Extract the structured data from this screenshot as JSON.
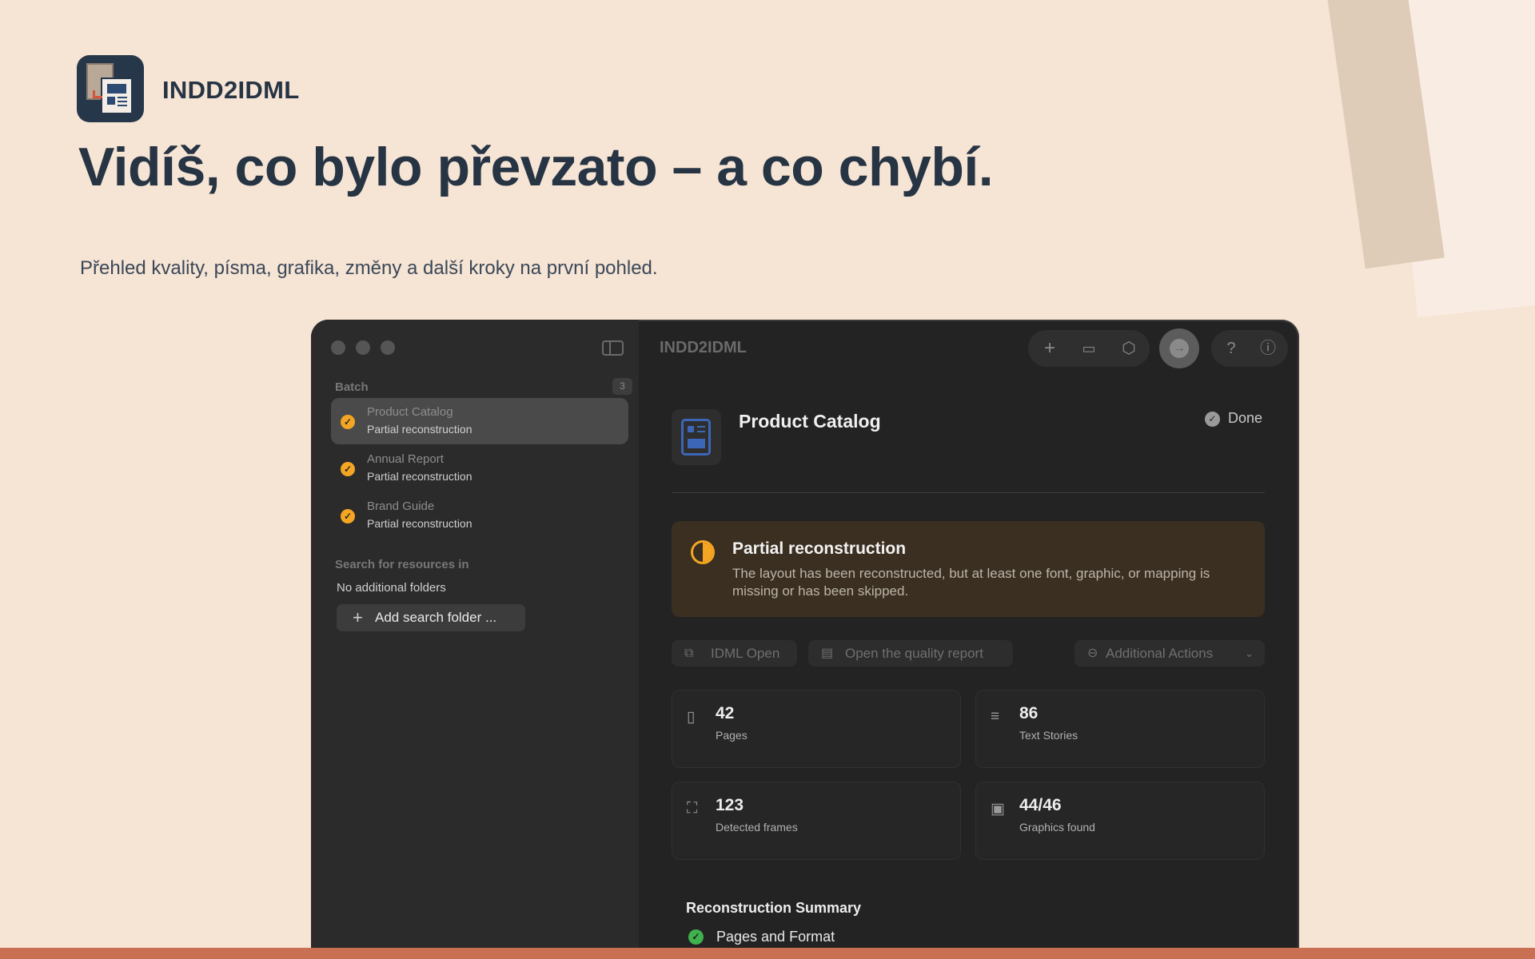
{
  "brand": {
    "name": "INDD2IDML"
  },
  "hero": {
    "headline": "Vidíš, co bylo převzato – a co chybí.",
    "subline": "Přehled kvality, písma, grafika, změny a další kroky na první pohled."
  },
  "window": {
    "title": "INDD2IDML",
    "toolbar": {
      "icons": [
        "plus-icon",
        "folder-icon",
        "package-icon",
        "convert-icon",
        "help-icon",
        "info-icon"
      ]
    }
  },
  "sidebar": {
    "batch_label": "Batch",
    "batch_count": "3",
    "items": [
      {
        "name": "Product Catalog",
        "status": "Partial reconstruction",
        "selected": true
      },
      {
        "name": "Annual Report",
        "status": "Partial reconstruction",
        "selected": false
      },
      {
        "name": "Brand Guide",
        "status": "Partial reconstruction",
        "selected": false
      }
    ],
    "search_label": "Search for resources in",
    "no_folders": "No additional folders",
    "add_folder": "Add search folder ..."
  },
  "document": {
    "title": "Product Catalog",
    "state": "Done"
  },
  "alert": {
    "title": "Partial reconstruction",
    "text": "The layout has been reconstructed, but at least one font, graphic, or mapping is missing or has been skipped."
  },
  "actions": {
    "open_idml": "IDML Open",
    "open_report": "Open the quality report",
    "more": "Additional Actions"
  },
  "stats": [
    {
      "value": "42",
      "label": "Pages"
    },
    {
      "value": "86",
      "label": "Text Stories"
    },
    {
      "value": "123",
      "label": "Detected frames"
    },
    {
      "value": "44/46",
      "label": "Graphics found"
    }
  ],
  "summary": {
    "title": "Reconstruction Summary",
    "items": [
      {
        "label": "Pages and Format"
      }
    ]
  },
  "colors": {
    "background": "#f6e4d4",
    "ink": "#263444",
    "accent_warning": "#f4a623",
    "accent_success": "#3fb24e",
    "bottom_bar": "#c96f52"
  }
}
